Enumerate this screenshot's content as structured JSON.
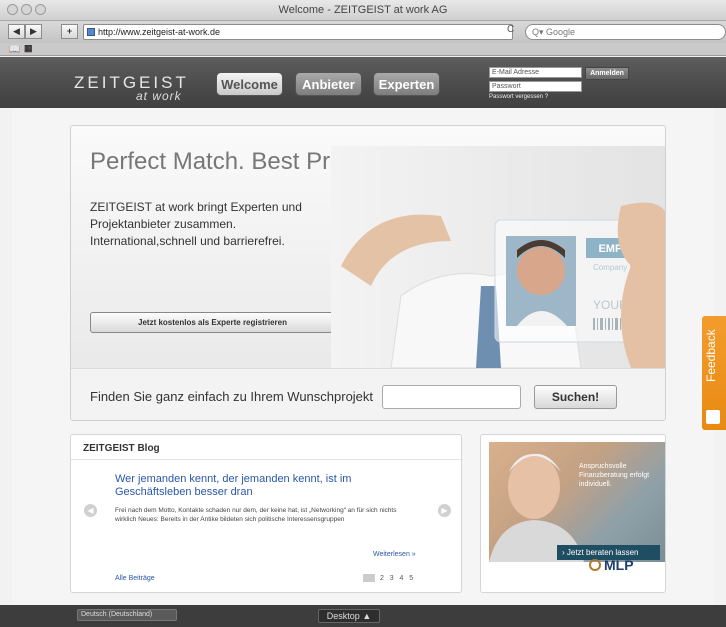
{
  "window": {
    "title": "Welcome - ZEITGEIST at work AG"
  },
  "toolbar": {
    "url": "http://www.zeitgeist-at-work.de",
    "reload": "C",
    "search_placeholder": "Q▾ Google"
  },
  "header": {
    "logo_main": "ZEITGEIST",
    "logo_sub": "at work",
    "nav": [
      {
        "label": "Welcome"
      },
      {
        "label": "Anbieter"
      },
      {
        "label": "Experten"
      }
    ],
    "email_placeholder": "E-Mail Adresse",
    "password_placeholder": "Passwort",
    "login_label": "Anmelden",
    "forgot_label": "Passwort vergessen ?"
  },
  "hero": {
    "title": "Perfect Match. Best Project.",
    "text": "ZEITGEIST at work bringt Experten und Projektanbieter zusammen. International,schnell und barrierefrei.",
    "register_label": "Jetzt kostenlos als Experte registrieren",
    "card_label": "EMPLOYEE",
    "card_company": "Company Inc.",
    "card_name": "YOUR NAME"
  },
  "search": {
    "label": "Finden Sie ganz einfach zu Ihrem Wunschprojekt",
    "button": "Suchen!"
  },
  "blog": {
    "heading": "ZEITGEIST Blog",
    "post_title": "Wer jemanden kennt, der jemanden kennt, ist im Geschäftsleben besser dran",
    "post_body": "Frei nach dem Motto, Kontakte schaden nur dem, der keine hat, ist „Networking“ an für sich nichts wirklich Neues: Bereits in der Antike bildeten sich politische Interessensgruppen",
    "read_more": "Weiterlesen »",
    "all_posts": "Alle Beiträge",
    "pages": [
      "2",
      "3",
      "4",
      "5"
    ]
  },
  "ad": {
    "text": "Anspruchsvolle Finanzberatung erfolgt individuell.",
    "cta": "› Jetzt beraten lassen",
    "brand": "MLP"
  },
  "feedback": {
    "label": "Feedback"
  },
  "statusbar": {
    "language": "Deutsch (Deutschland)",
    "desktop": "Desktop"
  }
}
